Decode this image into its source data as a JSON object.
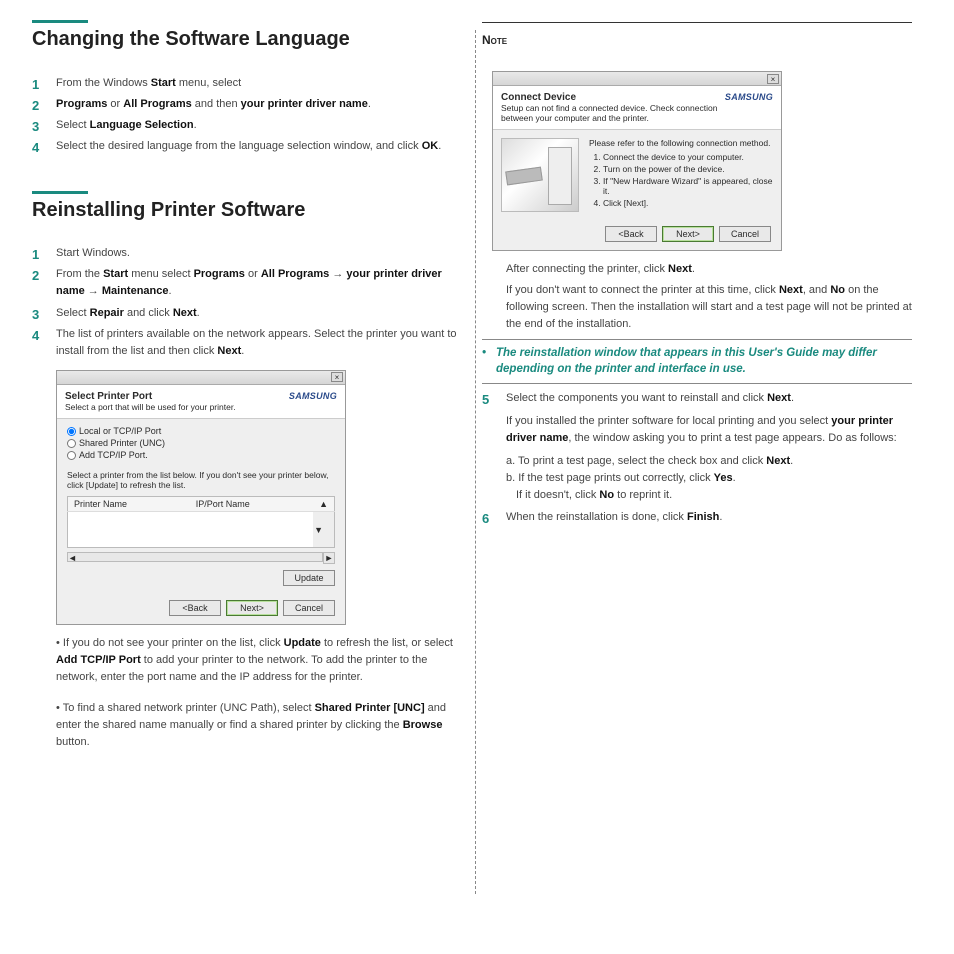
{
  "left": {
    "section1": {
      "title": "Changing the Software Language",
      "steps": [
        {
          "pre": "From the Windows ",
          "b1": "Start",
          "post": " menu, select"
        },
        {
          "pre": "",
          "b1": "Programs",
          "mid": " or ",
          "b2": "All Programs",
          "mid2": " and then ",
          "b3": "your printer driver name",
          "post": "."
        },
        {
          "pre": "Select ",
          "b1": "Language Selection",
          "post": "."
        },
        {
          "pre": "Select the desired language from the language selection window, and click ",
          "b1": "OK",
          "post": "."
        }
      ]
    },
    "section2": {
      "title": "Reinstalling Printer Software",
      "s1": "Start Windows.",
      "s2": {
        "pre": "From the ",
        "b1": "Start",
        "mid": " menu select ",
        "b2": "Programs",
        "mid2": " or ",
        "b3": "All Programs",
        "arrow": " → ",
        "b4": "your printer driver name",
        "arrow2": " → ",
        "b5": "Maintenance",
        "post": "."
      },
      "s3": {
        "pre": "Select ",
        "b1": "Repair",
        "mid": " and click ",
        "b2": "Next",
        "post": "."
      },
      "s4": {
        "pre": "The list of printers available on the network appears. Select the printer you want to install from the list and then click ",
        "b1": "Next",
        "post": "."
      }
    },
    "dlg1": {
      "title": "Select Printer Port",
      "subtitle": "Select a port that will be used for your printer.",
      "brand": "SAMSUNG",
      "opt1": "Local or TCP/IP Port",
      "opt2": "Shared Printer (UNC)",
      "opt3": "Add TCP/IP Port.",
      "instruct": "Select a printer from the list below. If you don't see your printer below, click [Update] to refresh the list.",
      "col1": "Printer Name",
      "col2": "IP/Port Name",
      "update": "Update",
      "back": "<Back",
      "next": "Next>",
      "cancel": "Cancel",
      "close": "×"
    },
    "after_dlg": {
      "p1_pre": "• If you do not see your printer on the list, click ",
      "p1_b": "Update",
      "p1_mid": " to refresh the list, or select ",
      "p1_b2": "Add TCP/IP Port",
      "p1_post": " to add your printer to the network. To add the printer to the network, enter the port name and the IP address for the printer.",
      "p2_pre": "• To find a shared network printer (UNC Path), select ",
      "p2_b": "Shared Printer [UNC]",
      "p2_mid": " and enter the shared name manually or find a shared printer by clicking the ",
      "p2_b2": "Browse",
      "p2_post": " button."
    }
  },
  "right": {
    "note_label": "Note",
    "dlg2": {
      "title": "Connect Device",
      "subtitle": "Setup can not find a connected device. Check connection between your computer and the printer.",
      "brand": "SAMSUNG",
      "lead": "Please refer to the following connection method.",
      "li1": "Connect the device to your computer.",
      "li2": "Turn on the power of the device.",
      "li3": "If \"New Hardware Wizard\" is appeared, close it.",
      "li4": "Click [Next].",
      "back": "<Back",
      "next": "Next>",
      "cancel": "Cancel",
      "close": "×"
    },
    "after2": {
      "p1_pre": "After connecting the printer, click ",
      "p1_b": "Next",
      "p1_post": ".",
      "p2_pre": "If you don't want to connect the printer at this time, click ",
      "p2_b": "Next",
      "p2_mid": ", and ",
      "p2_b2": "No",
      "p2_post": " on the following screen. Then the installation will start and a test page will not be printed at the end of the installation."
    },
    "callout": "The reinstallation window that appears in this User's Guide may differ depending on the printer and interface in use.",
    "s5": {
      "pre": "Select the components you want to reinstall and click ",
      "b1": "Next",
      "post": ".",
      "p2_pre": "If you installed the printer software for local printing and you select ",
      "p2_b": "your printer driver name",
      "p2_post": ", the window asking you to print a test page appears. Do as follows:",
      "a_pre": "a. To print a test page, select the check box and click ",
      "a_b": "Next",
      "a_post": ".",
      "b_pre": "b. If the test page prints out correctly, click ",
      "b_b": "Yes",
      "b_post": ".",
      "b2_pre": "If it doesn't, click ",
      "b2_b": "No",
      "b2_post": " to reprint it."
    },
    "s6": {
      "pre": "When the reinstallation is done, click ",
      "b": "Finish",
      "post": "."
    }
  }
}
